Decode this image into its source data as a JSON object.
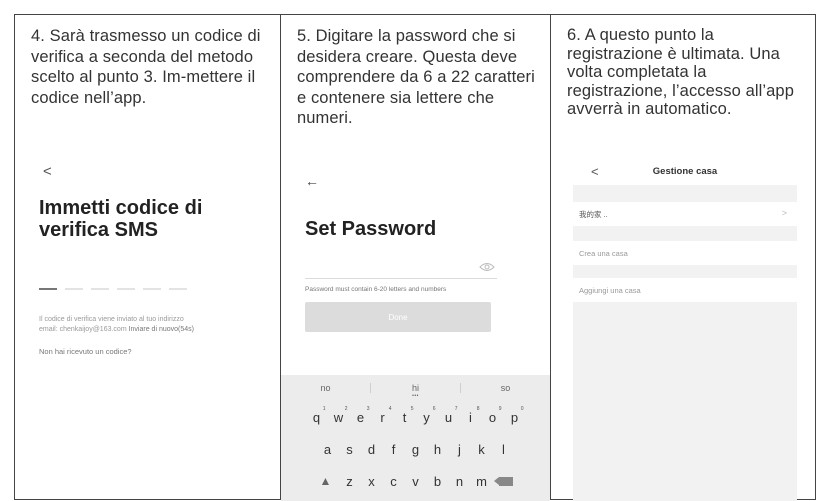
{
  "panels": [
    {
      "caption": "4. Sarà trasmesso un codice di verifica a seconda del metodo scelto al punto 3. Im-mettere il codice nell’app.",
      "screen": {
        "back_icon": "chevron-left-icon",
        "title": "Immetti codice di verifica SMS",
        "info_line1": "Il codice di verifica viene inviato al tuo indirizzo",
        "info_line2_prefix": "email: chenkaijoy@163.com ",
        "resend_label": "Inviare di nuovo(54s)",
        "no_code_link": "Non hai ricevuto un codice?"
      }
    },
    {
      "caption": "5. Digitare la password che si desidera creare. Questa deve comprendere da 6 a 22 caratteri e contenere sia lettere che numeri.",
      "screen": {
        "back_icon": "arrow-left-icon",
        "title": "Set Password",
        "eye_icon": "eye-icon",
        "hint": "Password must contain 6-20 letters and numbers",
        "done_label": "Done",
        "keyboard": {
          "suggestions": [
            "no",
            "hi",
            "so"
          ],
          "row1": [
            "q",
            "w",
            "e",
            "r",
            "t",
            "y",
            "u",
            "i",
            "o",
            "p"
          ],
          "row1_digits": [
            "1",
            "2",
            "3",
            "4",
            "5",
            "6",
            "7",
            "8",
            "9",
            "0"
          ],
          "row2": [
            "a",
            "s",
            "d",
            "f",
            "g",
            "h",
            "j",
            "k",
            "l"
          ],
          "row3": [
            "z",
            "x",
            "c",
            "v",
            "b",
            "n",
            "m"
          ],
          "shift_icon": "shift-icon",
          "delete_icon": "backspace-icon"
        }
      }
    },
    {
      "caption": "6. A questo punto la registrazione è ultimata. Una volta completata la registrazione, l’accesso all’app avverrà in automatico.",
      "screen": {
        "back_icon": "chevron-left-icon",
        "title": "Gestione casa",
        "home_item": "我的家 ..",
        "create_home": "Crea una casa",
        "add_home": "Aggiungi una casa"
      }
    }
  ]
}
